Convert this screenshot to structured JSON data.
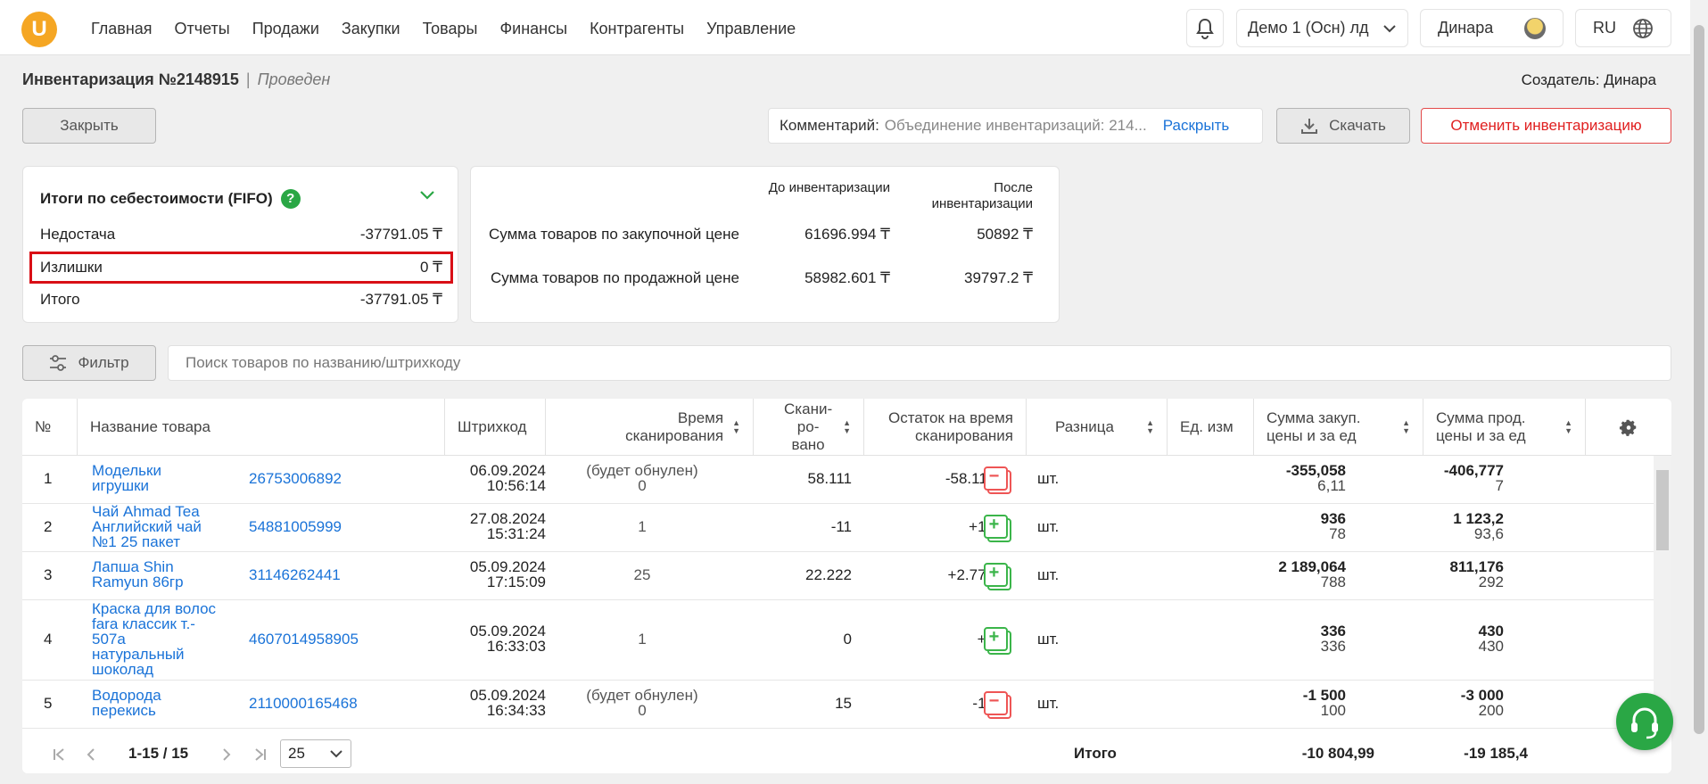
{
  "topbar": {
    "logo": "U",
    "nav": [
      "Главная",
      "Отчеты",
      "Продажи",
      "Закупки",
      "Товары",
      "Финансы",
      "Контрагенты",
      "Управление"
    ],
    "store": "Демо 1 (Осн) лд",
    "user": "Динара",
    "lang": "RU"
  },
  "header": {
    "title": "Инвентаризация №2148915",
    "separator": "|",
    "status": "Проведен",
    "creator": "Создатель: Динара"
  },
  "actions": {
    "close": "Закрыть",
    "comment_label": "Комментарий:",
    "comment_value": "Объединение инвентаризаций: 214...",
    "expand": "Раскрыть",
    "download": "Скачать",
    "cancel": "Отменить инвентаризацию"
  },
  "summary": {
    "title": "Итоги по себестоимости (FIFO)",
    "help": "?",
    "rows": [
      {
        "label": "Недостача",
        "value": "-37791.05 ₸"
      },
      {
        "label": "Излишки",
        "value": "0 ₸"
      },
      {
        "label": "Итого",
        "value": "-37791.05 ₸"
      }
    ]
  },
  "totals": {
    "col_before": "До инвентаризации",
    "col_after": "После инвентаризации",
    "rows": [
      {
        "label": "Сумма товаров по закупочной цене",
        "before": "61696.994 ₸",
        "after": "50892 ₸"
      },
      {
        "label": "Сумма товаров по продажной цене",
        "before": "58982.601 ₸",
        "after": "39797.2 ₸"
      }
    ]
  },
  "filter": {
    "label": "Фильтр",
    "placeholder": "Поиск товаров по названию/штрихкоду"
  },
  "table": {
    "headers": {
      "num": "№",
      "name": "Название товара",
      "barcode": "Штрихкод",
      "time": "Время сканирования",
      "scanned": "Скани-ро-вано",
      "remain": "Остаток на время сканирования",
      "diff": "Разница",
      "unit": "Ед. изм",
      "purchase": "Сумма закуп. цены и за ед",
      "sale": "Сумма прод. цены и за ед"
    },
    "rows": [
      {
        "num": "1",
        "name": "Модельки игрушки",
        "barcode": "26753006892",
        "date": "06.09.2024",
        "time": "10:56:14",
        "scan1": "(будет обнулен)",
        "scan2": "0",
        "remain": "58.111",
        "diff": "-58.111",
        "diff_type": "minus",
        "unit": "шт.",
        "p_total": "-355,058",
        "p_unit": "6,11",
        "s_total": "-406,777",
        "s_unit": "7"
      },
      {
        "num": "2",
        "name": "Чай Ahmad Tea Английский чай №1 25 пакет",
        "barcode": "54881005999",
        "date": "27.08.2024",
        "time": "15:31:24",
        "scan1": "",
        "scan2": "1",
        "remain": "-11",
        "diff": "+12",
        "diff_type": "plus",
        "unit": "шт.",
        "p_total": "936",
        "p_unit": "78",
        "s_total": "1 123,2",
        "s_unit": "93,6"
      },
      {
        "num": "3",
        "name": "Лапша Shin Ramyun 86гр",
        "barcode": "31146262441",
        "date": "05.09.2024",
        "time": "17:15:09",
        "scan1": "",
        "scan2": "25",
        "remain": "22.222",
        "diff": "+2.778",
        "diff_type": "plus",
        "unit": "шт.",
        "p_total": "2 189,064",
        "p_unit": "788",
        "s_total": "811,176",
        "s_unit": "292"
      },
      {
        "num": "4",
        "name": "Краска для волос fara классик т.- 507а натуральный шоколад",
        "barcode": "4607014958905",
        "date": "05.09.2024",
        "time": "16:33:03",
        "scan1": "",
        "scan2": "1",
        "remain": "0",
        "diff": "+1",
        "diff_type": "plus",
        "unit": "шт.",
        "p_total": "336",
        "p_unit": "336",
        "s_total": "430",
        "s_unit": "430"
      },
      {
        "num": "5",
        "name": "Водорода перекись",
        "barcode": "2110000165468",
        "date": "05.09.2024",
        "time": "16:34:33",
        "scan1": "(будет обнулен)",
        "scan2": "0",
        "remain": "15",
        "diff": "-15",
        "diff_type": "minus",
        "unit": "шт.",
        "p_total": "-1 500",
        "p_unit": "100",
        "s_total": "-3 000",
        "s_unit": "200"
      }
    ],
    "footer": {
      "range": "1-15 / 15",
      "page_size": "25",
      "total_label": "Итого",
      "total_purchase": "-10 804,99",
      "total_sale": "-19 185,4"
    }
  }
}
